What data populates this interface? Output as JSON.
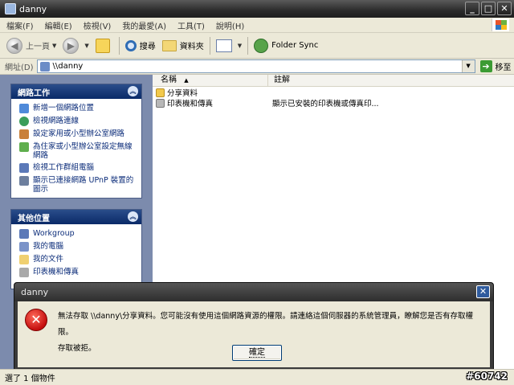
{
  "window": {
    "title": "danny"
  },
  "menu": [
    "檔案(F)",
    "編輯(E)",
    "檢視(V)",
    "我的最愛(A)",
    "工具(T)",
    "說明(H)"
  ],
  "toolbar": {
    "back_label": "上一頁",
    "search_label": "搜尋",
    "folders_label": "資料夾",
    "sync_label": "Folder Sync"
  },
  "address": {
    "label": "網址(D)",
    "value": "\\\\danny",
    "go_label": "移至"
  },
  "network_tasks": {
    "title": "網路工作",
    "items": [
      "新增一個網路位置",
      "檢視網路連線",
      "設定家用或小型辦公室網路",
      "為住家或小型辦公室設定無線網路",
      "檢視工作群組電腦",
      "顯示已連接網路 UPnP 裝置的圖示"
    ]
  },
  "other_places": {
    "title": "其他位置",
    "items": [
      "Workgroup",
      "我的電腦",
      "我的文件",
      "印表機和傳真"
    ]
  },
  "columns": {
    "name": "名稱",
    "comment": "註解"
  },
  "files": [
    {
      "name": "分享資料",
      "comment": ""
    },
    {
      "name": "印表機和傳真",
      "comment": "顯示已安裝的印表機或傳真印..."
    }
  ],
  "dialog": {
    "title": "danny",
    "message": "無法存取 \\\\danny\\分享資料。您可能沒有使用這個網路資源的權限。請連絡這個伺服器的系統管理員，瞭解您是否有存取權限。",
    "message2": "存取被拒。",
    "ok_label": "確定"
  },
  "status": {
    "text": "選了 1 個物件"
  },
  "watermark": "#60742",
  "colors": {
    "title_bar": "#2b2b2b",
    "task_header": "#0a2a68",
    "left_pane": "#7c8bad",
    "error_red": "#c40e0e"
  }
}
